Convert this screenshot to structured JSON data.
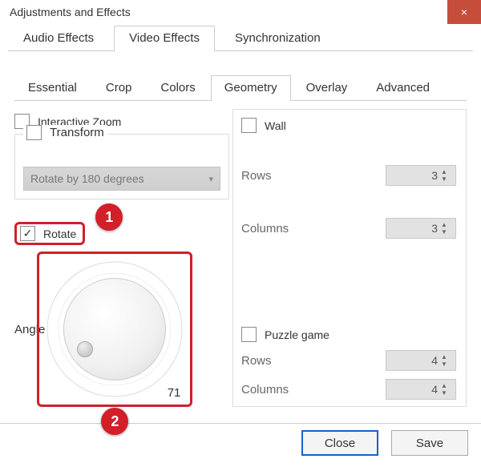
{
  "window": {
    "title": "Adjustments and Effects",
    "close": "×"
  },
  "tabs1": {
    "items": [
      "Audio Effects",
      "Video Effects",
      "Synchronization"
    ],
    "active": 1
  },
  "tabs2": {
    "items": [
      "Essential",
      "Crop",
      "Colors",
      "Geometry",
      "Overlay",
      "Advanced"
    ],
    "active": 3
  },
  "left": {
    "interactiveZoom": {
      "label": "Interactive Zoom",
      "checked": false
    },
    "transform": {
      "label": "Transform",
      "checked": false,
      "selected": "Rotate by 180 degrees"
    },
    "rotate": {
      "label": "Rotate",
      "checked": true
    },
    "angle": {
      "label": "Angle",
      "value": "71"
    }
  },
  "right": {
    "wall": {
      "label": "Wall",
      "checked": false,
      "rowsLabel": "Rows",
      "rows": "3",
      "colsLabel": "Columns",
      "cols": "3"
    },
    "puzzle": {
      "label": "Puzzle game",
      "checked": false,
      "rowsLabel": "Rows",
      "rows": "4",
      "colsLabel": "Columns",
      "cols": "4"
    }
  },
  "badges": {
    "one": "1",
    "two": "2"
  },
  "footer": {
    "close": "Close",
    "save": "Save"
  }
}
